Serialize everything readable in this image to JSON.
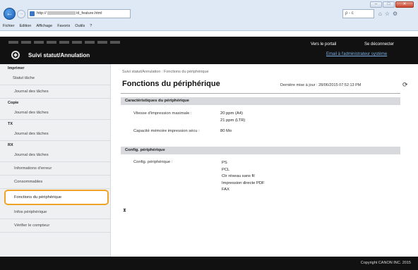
{
  "browser": {
    "address_prefix": "http://",
    "address_suffix": "/d_feature.html",
    "search_label": "ρ - c",
    "menu": [
      "Fichier",
      "Edition",
      "Affichage",
      "Favoris",
      "Outils",
      "?"
    ],
    "tab_icons": [
      "⌂",
      "☆",
      "⚙"
    ],
    "back_icon": "←",
    "forward_icon": "→"
  },
  "header": {
    "title": "Suivi statut/Annulation",
    "portal_link": "Vers le portail",
    "logout_link": "Se déconnecter",
    "admin_email_link": "Email à l'administrateur système"
  },
  "sidebar": {
    "sections": [
      {
        "heading": "Imprimer",
        "items": [
          "Statut tâche",
          "Journal des tâches"
        ]
      },
      {
        "heading": "Copie",
        "items": [
          "Journal des tâches"
        ]
      },
      {
        "heading": "TX",
        "items": [
          "Journal des tâches"
        ]
      },
      {
        "heading": "RX",
        "items": [
          "Journal des tâches"
        ]
      }
    ],
    "extra_items": [
      "Informations d'erreur",
      "Consommables",
      "Fonctions du périphérique",
      "Infos périphérique",
      "Vérifier le compteur"
    ],
    "active_item": "Fonctions du périphérique"
  },
  "main": {
    "breadcrumb": "Suivi statut/Annulation : Fonctions du périphérique",
    "title": "Fonctions du périphérique",
    "last_update": "Dernière mise à jour : 28/06/2015 07:52:13 PM",
    "characteristics": {
      "heading": "Caractéristiques du périphérique",
      "speed_label": "Vitesse d'impression maximale :",
      "speed_values": [
        "20 ppm (A4)",
        "21 ppm (LTR)"
      ],
      "memory_label": "Capacité mémoire impression sécu :",
      "memory_value": "80 Mo"
    },
    "config": {
      "heading": "Config. périphérique",
      "label": "Config. périphérique :",
      "features": [
        "PS",
        "PCL",
        "Ctr réseau sans fil",
        "Impression directe PDF",
        "FAX"
      ]
    },
    "top_icon": "⧗"
  },
  "footer": {
    "copyright": "Copyright CANON INC. 2015"
  }
}
